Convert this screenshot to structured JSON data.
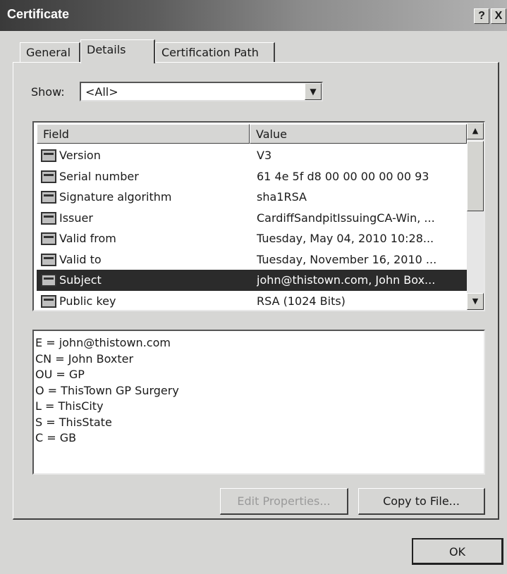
{
  "window": {
    "title": "Certificate",
    "help_button": "?",
    "close_button": "X"
  },
  "tabs": [
    {
      "label": "General",
      "active": false
    },
    {
      "label": "Details",
      "active": true
    },
    {
      "label": "Certification Path",
      "active": false
    }
  ],
  "show": {
    "label": "Show:",
    "selected": "<All>"
  },
  "field_list": {
    "columns": [
      "Field",
      "Value"
    ],
    "rows": [
      {
        "field": "Version",
        "value": "V3",
        "selected": false
      },
      {
        "field": "Serial number",
        "value": "61 4e 5f d8 00 00 00 00 00 93",
        "selected": false
      },
      {
        "field": "Signature algorithm",
        "value": "sha1RSA",
        "selected": false
      },
      {
        "field": "Issuer",
        "value": "CardiffSandpitIssuingCA-Win, ...",
        "selected": false
      },
      {
        "field": "Valid from",
        "value": "Tuesday, May 04, 2010 10:28...",
        "selected": false
      },
      {
        "field": "Valid to",
        "value": "Tuesday, November 16, 2010 ...",
        "selected": false
      },
      {
        "field": "Subject",
        "value": "john@thistown.com, John Box...",
        "selected": true
      },
      {
        "field": "Public key",
        "value": "RSA (1024 Bits)",
        "selected": false
      }
    ]
  },
  "detail_lines": [
    "E = john@thistown.com",
    "CN = John Boxter",
    "OU = GP",
    "O = ThisTown GP Surgery",
    "L = ThisCity",
    "S = ThisState",
    "C = GB"
  ],
  "buttons": {
    "edit_properties": "Edit Properties...",
    "copy_to_file": "Copy to File...",
    "ok": "OK"
  }
}
